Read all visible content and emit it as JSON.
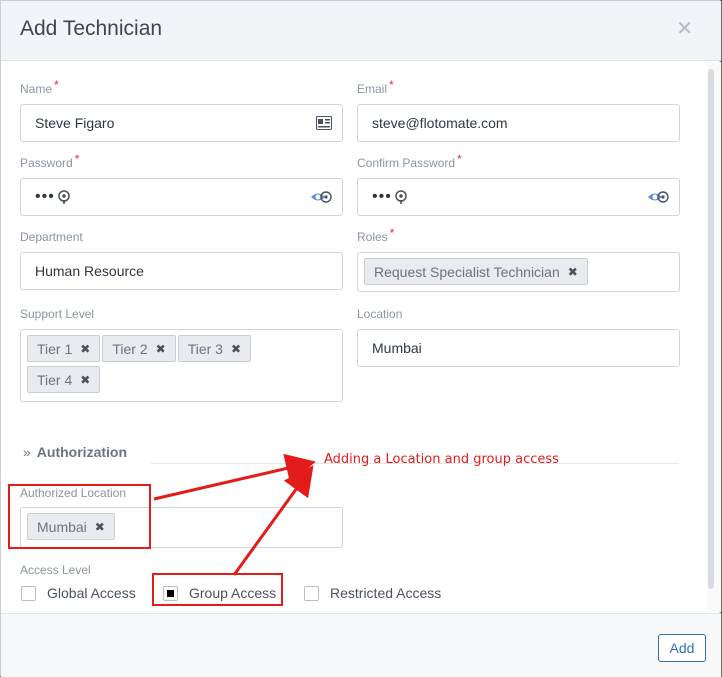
{
  "modal": {
    "title": "Add Technician"
  },
  "fields": {
    "name": {
      "label": "Name",
      "value": "Steve Figaro"
    },
    "email": {
      "label": "Email",
      "value": "steve@flotomate.com"
    },
    "password": {
      "label": "Password",
      "value": "•••"
    },
    "confirm_password": {
      "label": "Confirm Password",
      "value": "•••"
    },
    "department": {
      "label": "Department",
      "value": "Human Resource"
    },
    "roles": {
      "label": "Roles",
      "tags": [
        "Request Specialist Technician"
      ]
    },
    "support_level": {
      "label": "Support Level",
      "tags": [
        "Tier 1",
        "Tier 2",
        "Tier 3",
        "Tier 4"
      ]
    },
    "location": {
      "label": "Location",
      "value": "Mumbai"
    }
  },
  "authorization": {
    "section_title": "Authorization",
    "authorized_location": {
      "label": "Authorized Location",
      "tags": [
        "Mumbai"
      ]
    },
    "access_level": {
      "label": "Access Level",
      "options": [
        "Global Access",
        "Group Access",
        "Restricted Access"
      ],
      "selected": "Group Access"
    }
  },
  "footer": {
    "add_label": "Add"
  },
  "annotation": {
    "text": "Adding a Location and group access",
    "color": "#e41b1b"
  },
  "colors": {
    "required": "#e0313a",
    "accent": "#2e6fba"
  }
}
